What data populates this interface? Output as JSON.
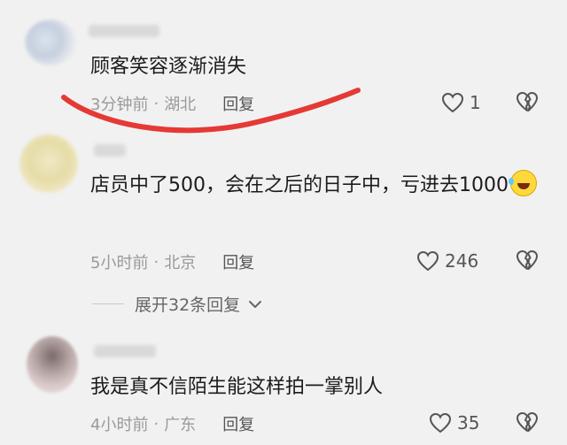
{
  "comments": [
    {
      "text": "顾客笑容逐渐消失",
      "time": "3分钟前",
      "sep": "·",
      "location": "湖北",
      "reply_label": "回复",
      "likes": "1"
    },
    {
      "text": "店员中了500，会在之后的日子中，亏进去1000",
      "emoji": "laughing-crying-emoji",
      "time": "5小时前",
      "sep": "·",
      "location": "北京",
      "reply_label": "回复",
      "likes": "246",
      "expand_label": "展开32条回复"
    },
    {
      "text": "我是真不信陌生能这样拍一掌别人",
      "time": "4小时前",
      "sep": "·",
      "location": "广东",
      "reply_label": "回复",
      "likes": "35"
    }
  ],
  "icons": {
    "like": "heart-outline-icon",
    "dislike": "broken-heart-icon",
    "expand": "chevron-down-icon"
  },
  "colors": {
    "background": "#f1f1f1",
    "meta_text": "#9a9a9a",
    "annotation_stroke": "#e53935"
  }
}
